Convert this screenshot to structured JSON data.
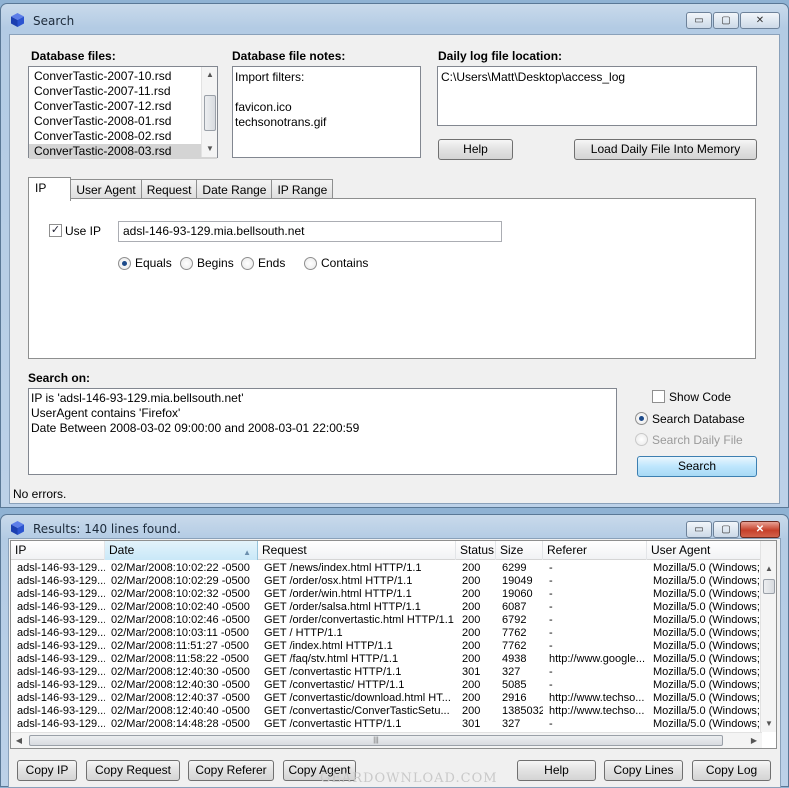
{
  "search_window": {
    "title": "Search",
    "window_buttons": {
      "minimize": "▭",
      "maximize": "▢",
      "close": "✕"
    },
    "database_files": {
      "label": "Database files:",
      "items": [
        "ConverTastic-2007-10.rsd",
        "ConverTastic-2007-11.rsd",
        "ConverTastic-2007-12.rsd",
        "ConverTastic-2008-01.rsd",
        "ConverTastic-2008-02.rsd",
        "ConverTastic-2008-03.rsd"
      ],
      "selected_index": 5
    },
    "database_notes": {
      "label": "Database file notes:",
      "lines": [
        "Import filters:",
        "",
        "favicon.ico",
        "techsonotrans.gif"
      ]
    },
    "daily_log": {
      "label": "Daily log file location:",
      "value": "C:\\Users\\Matt\\Desktop\\access_log"
    },
    "help_button": "Help",
    "load_daily_button": "Load Daily File Into Memory",
    "tabs": [
      "IP",
      "User Agent",
      "Request",
      "Date Range",
      "IP Range"
    ],
    "active_tab": "IP",
    "ip_panel": {
      "use_ip_label": "Use IP",
      "use_ip_checked": true,
      "ip_value": "adsl-146-93-129.mia.bellsouth.net",
      "match_options": [
        "Equals",
        "Begins",
        "Ends",
        "Contains"
      ],
      "selected_option": "Equals"
    },
    "search_on": {
      "label": "Search on:",
      "lines": [
        "IP is 'adsl-146-93-129.mia.bellsouth.net'",
        "UserAgent contains 'Firefox'",
        "Date Between 2008-03-02 09:00:00 and 2008-03-01 22:00:59"
      ]
    },
    "show_code_label": "Show Code",
    "search_database_label": "Search Database",
    "search_daily_label": "Search Daily File",
    "search_button": "Search",
    "status": "No errors."
  },
  "results_window": {
    "title": "Results: 140 lines found.",
    "columns": [
      "IP",
      "Date",
      "Request",
      "Status",
      "Size",
      "Referer",
      "User Agent"
    ],
    "sorted_column": "Date",
    "rows": [
      [
        "adsl-146-93-129...",
        "02/Mar/2008:10:02:22 -0500",
        "GET /news/index.html HTTP/1.1",
        "200",
        "6299",
        "-",
        "Mozilla/5.0 (Windows;"
      ],
      [
        "adsl-146-93-129...",
        "02/Mar/2008:10:02:29 -0500",
        "GET /order/osx.html HTTP/1.1",
        "200",
        "19049",
        "-",
        "Mozilla/5.0 (Windows;"
      ],
      [
        "adsl-146-93-129...",
        "02/Mar/2008:10:02:32 -0500",
        "GET /order/win.html HTTP/1.1",
        "200",
        "19060",
        "-",
        "Mozilla/5.0 (Windows;"
      ],
      [
        "adsl-146-93-129...",
        "02/Mar/2008:10:02:40 -0500",
        "GET /order/salsa.html HTTP/1.1",
        "200",
        "6087",
        "-",
        "Mozilla/5.0 (Windows;"
      ],
      [
        "adsl-146-93-129...",
        "02/Mar/2008:10:02:46 -0500",
        "GET /order/convertastic.html HTTP/1.1",
        "200",
        "6792",
        "-",
        "Mozilla/5.0 (Windows;"
      ],
      [
        "adsl-146-93-129...",
        "02/Mar/2008:10:03:11 -0500",
        "GET / HTTP/1.1",
        "200",
        "7762",
        "-",
        "Mozilla/5.0 (Windows;"
      ],
      [
        "adsl-146-93-129...",
        "02/Mar/2008:11:51:27 -0500",
        "GET /index.html HTTP/1.1",
        "200",
        "7762",
        "-",
        "Mozilla/5.0 (Windows;"
      ],
      [
        "adsl-146-93-129...",
        "02/Mar/2008:11:58:22 -0500",
        "GET /faq/stv.html HTTP/1.1",
        "200",
        "4938",
        "http://www.google...",
        "Mozilla/5.0 (Windows;"
      ],
      [
        "adsl-146-93-129...",
        "02/Mar/2008:12:40:30 -0500",
        "GET /convertastic HTTP/1.1",
        "301",
        "327",
        "-",
        "Mozilla/5.0 (Windows;"
      ],
      [
        "adsl-146-93-129...",
        "02/Mar/2008:12:40:30 -0500",
        "GET /convertastic/ HTTP/1.1",
        "200",
        "5085",
        "-",
        "Mozilla/5.0 (Windows;"
      ],
      [
        "adsl-146-93-129...",
        "02/Mar/2008:12:40:37 -0500",
        "GET /convertastic/download.html HT...",
        "200",
        "2916",
        "http://www.techso...",
        "Mozilla/5.0 (Windows;"
      ],
      [
        "adsl-146-93-129...",
        "02/Mar/2008:12:40:40 -0500",
        "GET /convertastic/ConverTasticSetu...",
        "200",
        "1385032",
        "http://www.techso...",
        "Mozilla/5.0 (Windows;"
      ],
      [
        "adsl-146-93-129...",
        "02/Mar/2008:14:48:28 -0500",
        "GET /convertastic HTTP/1.1",
        "301",
        "327",
        "-",
        "Mozilla/5.0 (Windows;"
      ]
    ],
    "buttons": {
      "copy_ip": "Copy IP",
      "copy_request": "Copy Request",
      "copy_referer": "Copy Referer",
      "copy_agent": "Copy Agent",
      "help": "Help",
      "copy_lines": "Copy Lines",
      "copy_log": "Copy Log"
    }
  },
  "watermark": "GEARDOWNLOAD.COM",
  "colors": {
    "title_bar": "#b9cfe6",
    "close_button": "#c6402a",
    "accent": "#1c4a8a"
  },
  "icons": {
    "app": "blue-cube-icon",
    "sort": "sort-ascending-icon"
  }
}
